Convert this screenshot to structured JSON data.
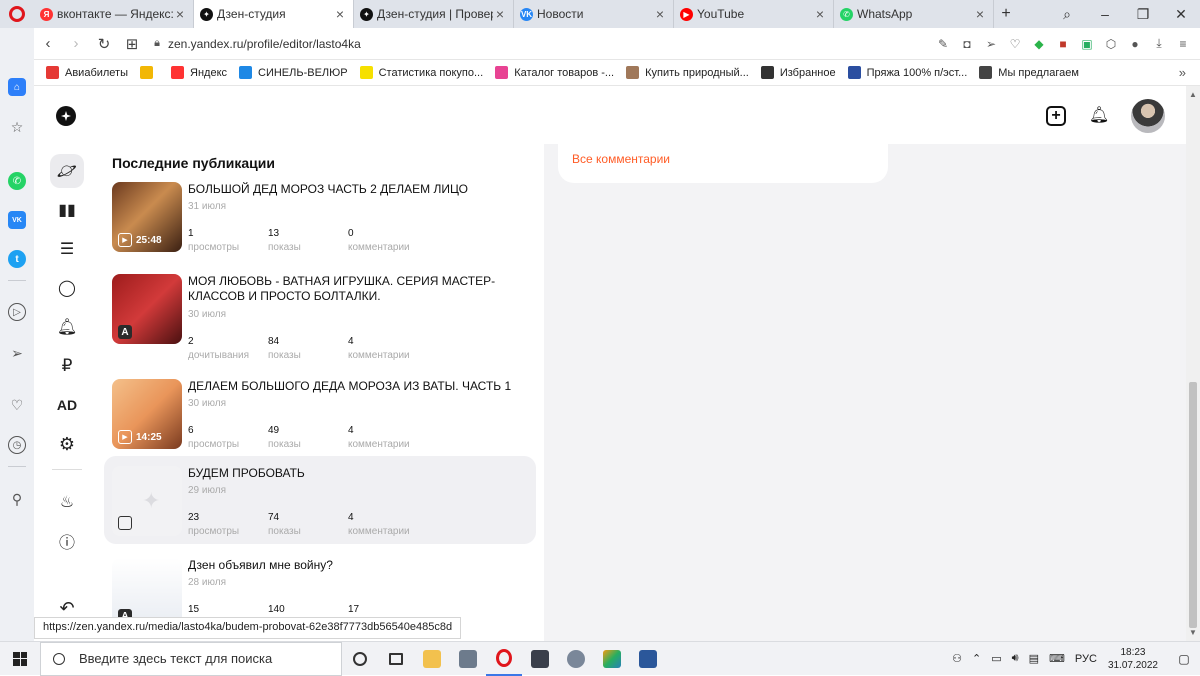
{
  "browser": {
    "tabs": [
      {
        "title": "вконтакте — Яндекс: на",
        "icon": "yandex-icon",
        "color": "#ff3333",
        "glyph": "Я",
        "active": false
      },
      {
        "title": "Дзен-студия",
        "icon": "zen-icon",
        "color": "#111111",
        "glyph": "✦",
        "active": true
      },
      {
        "title": "Дзен-студия | Проверка",
        "icon": "zen-icon",
        "color": "#111111",
        "glyph": "✦",
        "active": false
      },
      {
        "title": "Новости",
        "icon": "vk-icon",
        "color": "#2787f5",
        "glyph": "VK",
        "active": false
      },
      {
        "title": "YouTube",
        "icon": "youtube-icon",
        "color": "#ff0000",
        "glyph": "▶",
        "active": false
      },
      {
        "title": "WhatsApp",
        "icon": "whatsapp-icon",
        "color": "#25d366",
        "glyph": "✆",
        "active": false
      }
    ],
    "url": "zen.yandex.ru/profile/editor/lasto4ka",
    "bookmarks": [
      {
        "label": "Авиабилеты",
        "color": "#e53935"
      },
      {
        "label": "",
        "color": "#f2b705"
      },
      {
        "label": "Яндекс",
        "color": "#ff3333"
      },
      {
        "label": "СИНЕЛЬ-ВЕЛЮР",
        "color": "#1e88e5"
      },
      {
        "label": "Статистика покупо...",
        "color": "#f6e000"
      },
      {
        "label": "Каталог товаров -...",
        "color": "#e84393"
      },
      {
        "label": "Купить природный...",
        "color": "#a0785a"
      },
      {
        "label": "Избранное",
        "color": "#333333"
      },
      {
        "label": "Пряжа 100% п/эст...",
        "color": "#2b4ea0"
      },
      {
        "label": "Мы предлагаем",
        "color": "#444444"
      }
    ],
    "more": "»",
    "status_url": "https://zen.yandex.ru/media/lasto4ka/budem-probovat-62e38f7773db56540e485c8d"
  },
  "studio": {
    "publications": {
      "title": "Последние публикации",
      "items": [
        {
          "title": "БОЛЬШОЙ ДЕД МОРОЗ ЧАСТЬ 2 ДЕЛАЕМ ЛИЦО",
          "date": "31 июля",
          "type": "video",
          "duration": "25:48",
          "stats": [
            {
              "value": "1",
              "label": "просмотры"
            },
            {
              "value": "13",
              "label": "показы"
            },
            {
              "value": "0",
              "label": "комментарии"
            }
          ]
        },
        {
          "title": "МОЯ ЛЮБОВЬ - ВАТНАЯ ИГРУШКА. СЕРИЯ МАСТЕР-КЛАССОВ И ПРОСТО БОЛТАЛКИ.",
          "date": "30 июля",
          "type": "article",
          "duration": "",
          "stats": [
            {
              "value": "2",
              "label": "дочитывания"
            },
            {
              "value": "84",
              "label": "показы"
            },
            {
              "value": "4",
              "label": "комментарии"
            }
          ]
        },
        {
          "title": "ДЕЛАЕМ БОЛЬШОГО ДЕДА МОРОЗА ИЗ ВАТЫ. ЧАСТЬ 1",
          "date": "30 июля",
          "type": "video",
          "duration": "14:25",
          "stats": [
            {
              "value": "6",
              "label": "просмотры"
            },
            {
              "value": "49",
              "label": "показы"
            },
            {
              "value": "4",
              "label": "комментарии"
            }
          ]
        },
        {
          "title": "БУДЕМ ПРОБОВАТЬ",
          "date": "29 июля",
          "type": "post",
          "duration": "",
          "stats": [
            {
              "value": "23",
              "label": "просмотры"
            },
            {
              "value": "74",
              "label": "показы"
            },
            {
              "value": "4",
              "label": "комментарии"
            }
          ]
        },
        {
          "title": "Дзен объявил мне войну?",
          "date": "28 июля",
          "type": "article",
          "duration": "",
          "stats": [
            {
              "value": "15",
              "label": ""
            },
            {
              "value": "140",
              "label": ""
            },
            {
              "value": "17",
              "label": ""
            }
          ]
        }
      ]
    },
    "comments": {
      "all_link": "Все комментарии"
    },
    "nav_ad_label": "AD",
    "nav_ruble": "₽"
  },
  "taskbar": {
    "search_placeholder": "Введите здесь текст для поиска",
    "lang": "РУС",
    "time": "18:23",
    "date": "31.07.2022"
  },
  "colors": {
    "accent": "#ff5c26",
    "opera_red": "#e0161c"
  }
}
